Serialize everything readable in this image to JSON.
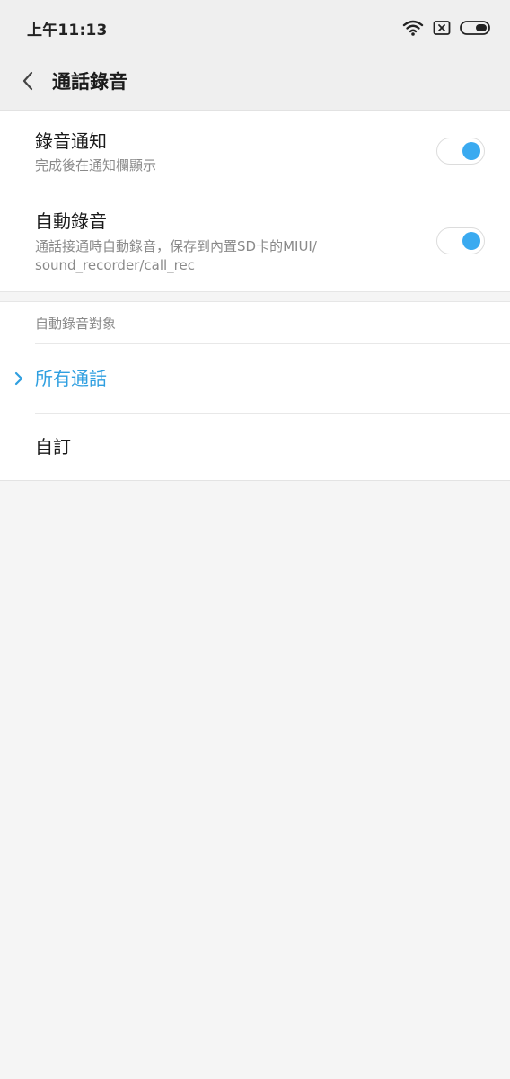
{
  "status_bar": {
    "time": "上午11:13",
    "icons": [
      "wifi-icon",
      "sim-x-icon",
      "battery-icon"
    ]
  },
  "header": {
    "title": "通話錄音",
    "back_icon": "back-arrow-icon"
  },
  "settings": [
    {
      "title": "錄音通知",
      "subtitle": "完成後在通知欄顯示",
      "enabled": true
    },
    {
      "title": "自動錄音",
      "subtitle_line1": "通話接通時自動錄音，保存到內置SD卡的MIUI/",
      "subtitle_line2": "sound_recorder/call_rec",
      "enabled": true
    }
  ],
  "auto_record_target": {
    "header": "自動錄音對象",
    "options": [
      {
        "label": "所有通話",
        "selected": true
      },
      {
        "label": "自訂",
        "selected": false
      }
    ]
  },
  "colors": {
    "accent": "#3aaaf0",
    "selected_text": "#2f9fe0",
    "background": "#f5f5f5",
    "card": "#ffffff"
  }
}
